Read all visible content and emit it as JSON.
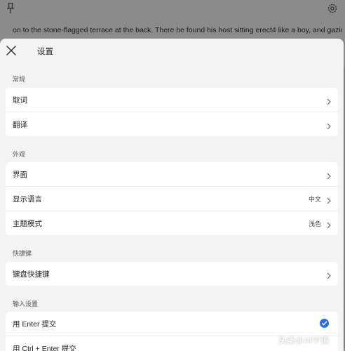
{
  "background": {
    "text": "on to the stone-flagged terrace at the back. There he found his host sitting erect4 like a boy, and gazing so"
  },
  "sheet": {
    "title": "设置",
    "sections": {
      "general": {
        "label": "常规",
        "items": [
          {
            "label": "取词"
          },
          {
            "label": "翻译"
          }
        ]
      },
      "appearance": {
        "label": "外观",
        "items": [
          {
            "label": "界面"
          },
          {
            "label": "显示语言",
            "value": "中文"
          },
          {
            "label": "主题模式",
            "value": "浅色"
          }
        ]
      },
      "shortcuts": {
        "label": "快捷键",
        "items": [
          {
            "label": "键盘快捷键"
          }
        ]
      },
      "input": {
        "label": "输入设置",
        "items": [
          {
            "label": "用 Enter 提交",
            "checked": true
          },
          {
            "label": "用 Ctrl + Enter 提交"
          }
        ]
      }
    }
  },
  "watermark": {
    "prefix": "头条",
    "handle": "@APP猿"
  },
  "colors": {
    "accent": "#2f6fd6",
    "sheet_bg": "#f3f3f3",
    "card_bg": "#ffffff",
    "overlay": "#8b8b8b"
  },
  "icons": {
    "top_left": "pin-icon",
    "top_right": "gear-icon",
    "close": "close-icon",
    "row_arrow": "chevron-right-icon",
    "selected": "check-circle-icon"
  }
}
